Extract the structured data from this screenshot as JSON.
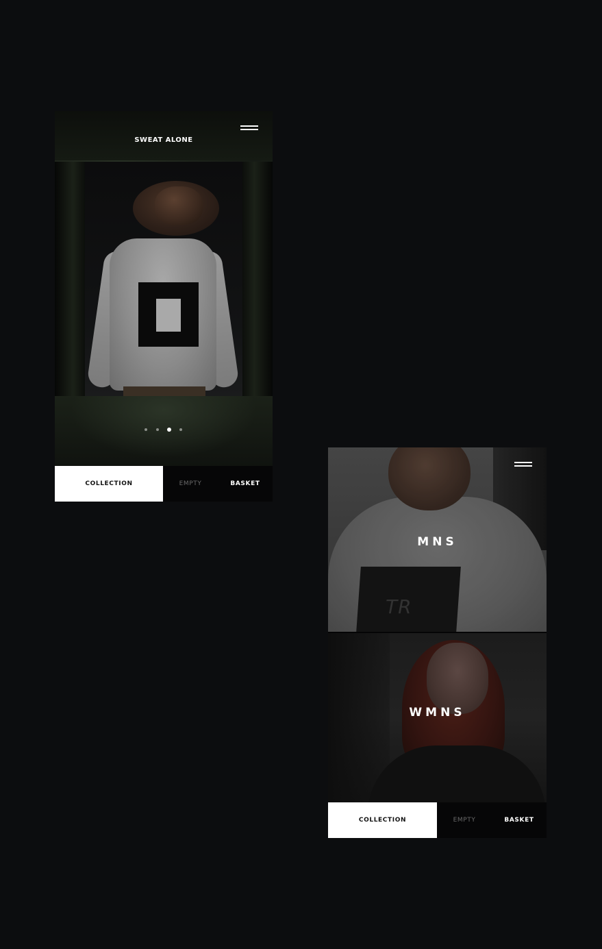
{
  "screen_1": {
    "brand_title": "SWEAT ALONE",
    "carousel": {
      "page_count": 4,
      "active_page": 3
    },
    "bottom_nav": {
      "collection_label": "COLLECTION",
      "empty_label": "EMPTY",
      "basket_label": "BASKET"
    }
  },
  "screen_2": {
    "categories": [
      {
        "label": "MNS"
      },
      {
        "label": "WMNS"
      }
    ],
    "shirt_print_text": "TR",
    "bottom_nav": {
      "collection_label": "COLLECTION",
      "empty_label": "EMPTY",
      "basket_label": "BASKET"
    }
  },
  "colors": {
    "background": "#0c0d0f",
    "active_tab_background": "#ffffff",
    "active_tab_text": "#111111",
    "inactive_tab_text": "#6b6b6b",
    "accent_text": "#ffffff"
  },
  "icons": [
    "hamburger-menu-icon",
    "carousel-dot-icon"
  ]
}
